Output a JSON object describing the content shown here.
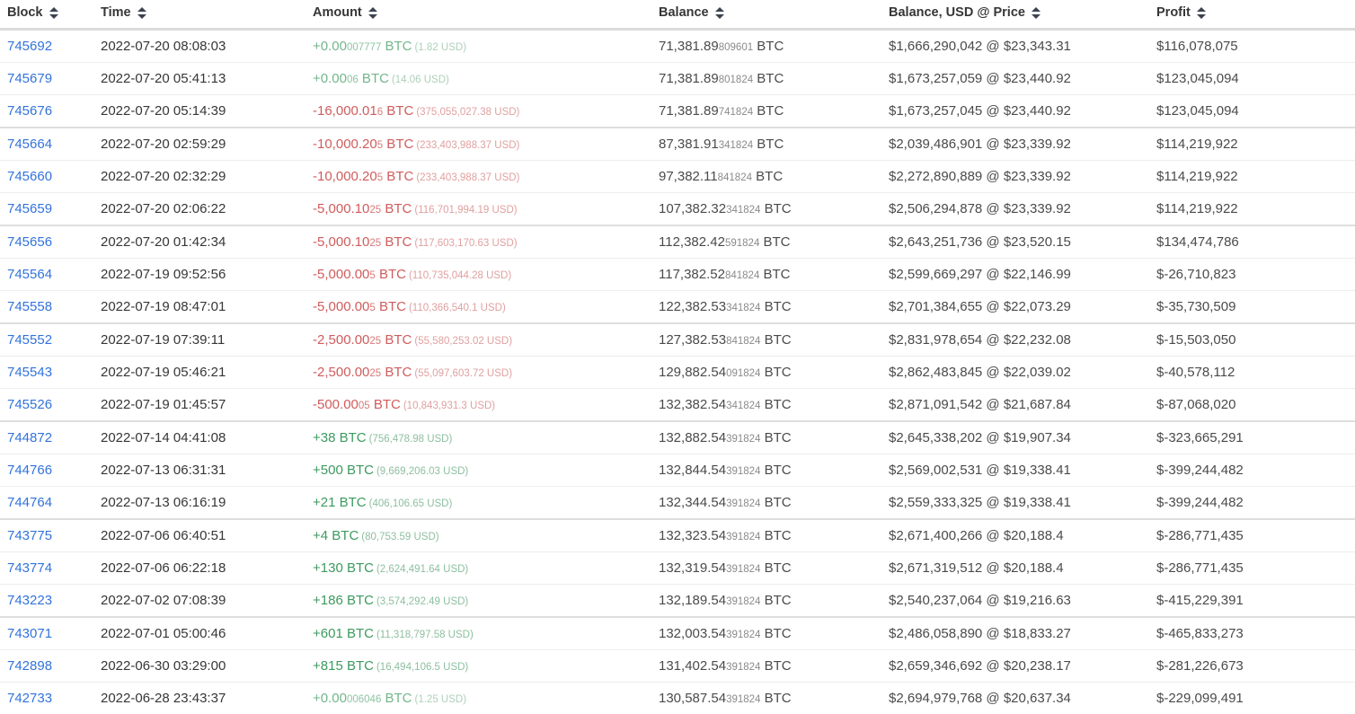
{
  "table": {
    "columns": [
      {
        "key": "block",
        "label": "Block",
        "sort_icon": "sort-both-icon"
      },
      {
        "key": "time",
        "label": "Time",
        "sort_icon": "sort-both-icon"
      },
      {
        "key": "amount",
        "label": "Amount",
        "sort_icon": "sort-both-icon"
      },
      {
        "key": "balance",
        "label": "Balance",
        "sort_icon": "sort-both-icon"
      },
      {
        "key": "usd",
        "label": "Balance, USD @ Price",
        "sort_icon": "sort-both-icon"
      },
      {
        "key": "profit",
        "label": "Profit",
        "sort_icon": "sort-both-icon"
      }
    ],
    "colors": {
      "link": "#3273dc",
      "positive": "#3c9a5f",
      "negative": "#d05c5c",
      "text": "#4a4a4a",
      "header_text": "#363636",
      "row_border": "#ededed",
      "header_border": "#dbdbdb"
    },
    "unit": "BTC",
    "rows": [
      {
        "block": "745692",
        "time": "2022-07-20 08:08:03",
        "amount_sign": "pos",
        "amount_main": "+0.00",
        "amount_frac": "007777",
        "amount_unit": "BTC",
        "amount_usd": "(1.82 USD)",
        "amount_faint": true,
        "balance_main": "71,381.89",
        "balance_frac": "809601",
        "balance_unit": "BTC",
        "usd": "$1,666,290,042 @ $23,343.31",
        "profit": "$116,078,075"
      },
      {
        "block": "745679",
        "time": "2022-07-20 05:41:13",
        "amount_sign": "pos",
        "amount_main": "+0.00",
        "amount_frac": "06",
        "amount_unit": "BTC",
        "amount_usd": "(14.06 USD)",
        "amount_faint": true,
        "balance_main": "71,381.89",
        "balance_frac": "801824",
        "balance_unit": "BTC",
        "usd": "$1,673,257,059 @ $23,440.92",
        "profit": "$123,045,094"
      },
      {
        "block": "745676",
        "time": "2022-07-20 05:14:39",
        "amount_sign": "neg",
        "amount_main": "-16,000.01",
        "amount_frac": "6",
        "amount_unit": "BTC",
        "amount_usd": "(375,055,027.38 USD)",
        "amount_faint": false,
        "balance_main": "71,381.89",
        "balance_frac": "741824",
        "balance_unit": "BTC",
        "usd": "$1,673,257,045 @ $23,440.92",
        "profit": "$123,045,094"
      },
      {
        "block": "745664",
        "time": "2022-07-20 02:59:29",
        "amount_sign": "neg",
        "amount_main": "-10,000.20",
        "amount_frac": "5",
        "amount_unit": "BTC",
        "amount_usd": "(233,403,988.37 USD)",
        "amount_faint": false,
        "balance_main": "87,381.91",
        "balance_frac": "341824",
        "balance_unit": "BTC",
        "usd": "$2,039,486,901 @ $23,339.92",
        "profit": "$114,219,922"
      },
      {
        "block": "745660",
        "time": "2022-07-20 02:32:29",
        "amount_sign": "neg",
        "amount_main": "-10,000.20",
        "amount_frac": "5",
        "amount_unit": "BTC",
        "amount_usd": "(233,403,988.37 USD)",
        "amount_faint": false,
        "balance_main": "97,382.11",
        "balance_frac": "841824",
        "balance_unit": "BTC",
        "usd": "$2,272,890,889 @ $23,339.92",
        "profit": "$114,219,922"
      },
      {
        "block": "745659",
        "time": "2022-07-20 02:06:22",
        "amount_sign": "neg",
        "amount_main": "-5,000.10",
        "amount_frac": "25",
        "amount_unit": "BTC",
        "amount_usd": "(116,701,994.19 USD)",
        "amount_faint": false,
        "balance_main": "107,382.32",
        "balance_frac": "341824",
        "balance_unit": "BTC",
        "usd": "$2,506,294,878 @ $23,339.92",
        "profit": "$114,219,922"
      },
      {
        "block": "745656",
        "time": "2022-07-20 01:42:34",
        "amount_sign": "neg",
        "amount_main": "-5,000.10",
        "amount_frac": "25",
        "amount_unit": "BTC",
        "amount_usd": "(117,603,170.63 USD)",
        "amount_faint": false,
        "balance_main": "112,382.42",
        "balance_frac": "591824",
        "balance_unit": "BTC",
        "usd": "$2,643,251,736 @ $23,520.15",
        "profit": "$134,474,786"
      },
      {
        "block": "745564",
        "time": "2022-07-19 09:52:56",
        "amount_sign": "neg",
        "amount_main": "-5,000.00",
        "amount_frac": "5",
        "amount_unit": "BTC",
        "amount_usd": "(110,735,044.28 USD)",
        "amount_faint": false,
        "balance_main": "117,382.52",
        "balance_frac": "841824",
        "balance_unit": "BTC",
        "usd": "$2,599,669,297 @ $22,146.99",
        "profit": "$-26,710,823"
      },
      {
        "block": "745558",
        "time": "2022-07-19 08:47:01",
        "amount_sign": "neg",
        "amount_main": "-5,000.00",
        "amount_frac": "5",
        "amount_unit": "BTC",
        "amount_usd": "(110,366,540.1 USD)",
        "amount_faint": false,
        "balance_main": "122,382.53",
        "balance_frac": "341824",
        "balance_unit": "BTC",
        "usd": "$2,701,384,655 @ $22,073.29",
        "profit": "$-35,730,509"
      },
      {
        "block": "745552",
        "time": "2022-07-19 07:39:11",
        "amount_sign": "neg",
        "amount_main": "-2,500.00",
        "amount_frac": "25",
        "amount_unit": "BTC",
        "amount_usd": "(55,580,253.02 USD)",
        "amount_faint": false,
        "balance_main": "127,382.53",
        "balance_frac": "841824",
        "balance_unit": "BTC",
        "usd": "$2,831,978,654 @ $22,232.08",
        "profit": "$-15,503,050"
      },
      {
        "block": "745543",
        "time": "2022-07-19 05:46:21",
        "amount_sign": "neg",
        "amount_main": "-2,500.00",
        "amount_frac": "25",
        "amount_unit": "BTC",
        "amount_usd": "(55,097,603.72 USD)",
        "amount_faint": false,
        "balance_main": "129,882.54",
        "balance_frac": "091824",
        "balance_unit": "BTC",
        "usd": "$2,862,483,845 @ $22,039.02",
        "profit": "$-40,578,112"
      },
      {
        "block": "745526",
        "time": "2022-07-19 01:45:57",
        "amount_sign": "neg",
        "amount_main": "-500.00",
        "amount_frac": "05",
        "amount_unit": "BTC",
        "amount_usd": "(10,843,931.3 USD)",
        "amount_faint": false,
        "balance_main": "132,382.54",
        "balance_frac": "341824",
        "balance_unit": "BTC",
        "usd": "$2,871,091,542 @ $21,687.84",
        "profit": "$-87,068,020"
      },
      {
        "block": "744872",
        "time": "2022-07-14 04:41:08",
        "amount_sign": "pos",
        "amount_main": "+38",
        "amount_frac": "",
        "amount_unit": "BTC",
        "amount_usd": "(756,478.98 USD)",
        "amount_faint": false,
        "balance_main": "132,882.54",
        "balance_frac": "391824",
        "balance_unit": "BTC",
        "usd": "$2,645,338,202 @ $19,907.34",
        "profit": "$-323,665,291"
      },
      {
        "block": "744766",
        "time": "2022-07-13 06:31:31",
        "amount_sign": "pos",
        "amount_main": "+500",
        "amount_frac": "",
        "amount_unit": "BTC",
        "amount_usd": "(9,669,206.03 USD)",
        "amount_faint": false,
        "balance_main": "132,844.54",
        "balance_frac": "391824",
        "balance_unit": "BTC",
        "usd": "$2,569,002,531 @ $19,338.41",
        "profit": "$-399,244,482"
      },
      {
        "block": "744764",
        "time": "2022-07-13 06:16:19",
        "amount_sign": "pos",
        "amount_main": "+21",
        "amount_frac": "",
        "amount_unit": "BTC",
        "amount_usd": "(406,106.65 USD)",
        "amount_faint": false,
        "balance_main": "132,344.54",
        "balance_frac": "391824",
        "balance_unit": "BTC",
        "usd": "$2,559,333,325 @ $19,338.41",
        "profit": "$-399,244,482"
      },
      {
        "block": "743775",
        "time": "2022-07-06 06:40:51",
        "amount_sign": "pos",
        "amount_main": "+4",
        "amount_frac": "",
        "amount_unit": "BTC",
        "amount_usd": "(80,753.59 USD)",
        "amount_faint": false,
        "balance_main": "132,323.54",
        "balance_frac": "391824",
        "balance_unit": "BTC",
        "usd": "$2,671,400,266 @ $20,188.4",
        "profit": "$-286,771,435"
      },
      {
        "block": "743774",
        "time": "2022-07-06 06:22:18",
        "amount_sign": "pos",
        "amount_main": "+130",
        "amount_frac": "",
        "amount_unit": "BTC",
        "amount_usd": "(2,624,491.64 USD)",
        "amount_faint": false,
        "balance_main": "132,319.54",
        "balance_frac": "391824",
        "balance_unit": "BTC",
        "usd": "$2,671,319,512 @ $20,188.4",
        "profit": "$-286,771,435"
      },
      {
        "block": "743223",
        "time": "2022-07-02 07:08:39",
        "amount_sign": "pos",
        "amount_main": "+186",
        "amount_frac": "",
        "amount_unit": "BTC",
        "amount_usd": "(3,574,292.49 USD)",
        "amount_faint": false,
        "balance_main": "132,189.54",
        "balance_frac": "391824",
        "balance_unit": "BTC",
        "usd": "$2,540,237,064 @ $19,216.63",
        "profit": "$-415,229,391"
      },
      {
        "block": "743071",
        "time": "2022-07-01 05:00:46",
        "amount_sign": "pos",
        "amount_main": "+601",
        "amount_frac": "",
        "amount_unit": "BTC",
        "amount_usd": "(11,318,797.58 USD)",
        "amount_faint": false,
        "balance_main": "132,003.54",
        "balance_frac": "391824",
        "balance_unit": "BTC",
        "usd": "$2,486,058,890 @ $18,833.27",
        "profit": "$-465,833,273"
      },
      {
        "block": "742898",
        "time": "2022-06-30 03:29:00",
        "amount_sign": "pos",
        "amount_main": "+815",
        "amount_frac": "",
        "amount_unit": "BTC",
        "amount_usd": "(16,494,106.5 USD)",
        "amount_faint": false,
        "balance_main": "131,402.54",
        "balance_frac": "391824",
        "balance_unit": "BTC",
        "usd": "$2,659,346,692 @ $20,238.17",
        "profit": "$-281,226,673"
      },
      {
        "block": "742733",
        "time": "2022-06-28 23:43:37",
        "amount_sign": "pos",
        "amount_main": "+0.00",
        "amount_frac": "006046",
        "amount_unit": "BTC",
        "amount_usd": "(1.25 USD)",
        "amount_faint": true,
        "balance_main": "130,587.54",
        "balance_frac": "391824",
        "balance_unit": "BTC",
        "usd": "$2,694,979,768 @ $20,637.34",
        "profit": "$-229,099,491"
      }
    ]
  }
}
